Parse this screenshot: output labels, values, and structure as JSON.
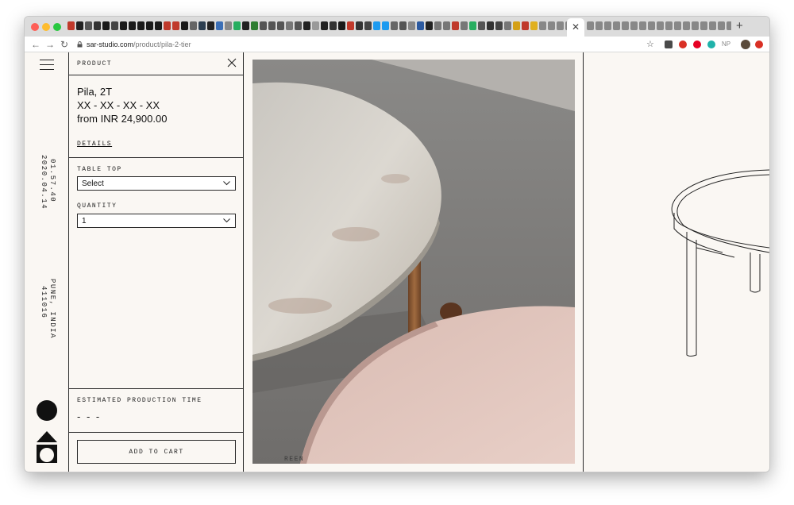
{
  "browser": {
    "url_host": "sar-studio.com",
    "url_path": "/product/pila-2-tier",
    "ext_np_label": "NP"
  },
  "side": {
    "time": "01.57.40",
    "date": "2020.04.14",
    "city": "PUNE, INDIA",
    "zip": "411016"
  },
  "product": {
    "header": "PRODUCT",
    "name": "Pila, 2T",
    "variant": "XX - XX - XX - XX",
    "price": "from INR 24,900.00",
    "details_link": "DETAILS",
    "table_top_label": "TABLE TOP",
    "table_top_value": "Select",
    "quantity_label": "QUANTITY",
    "quantity_value": "1",
    "production_label": "ESTIMATED PRODUCTION TIME",
    "production_value": "- - -",
    "add_to_cart": "ADD TO CART"
  },
  "photo": {
    "caption": "REEN"
  },
  "colors": {
    "page_bg": "#faf7f3",
    "ink": "#2a2a2a",
    "marble": "#d9d6d0",
    "pink_top": "#e3c8c0",
    "wood": "#8a5a34"
  }
}
